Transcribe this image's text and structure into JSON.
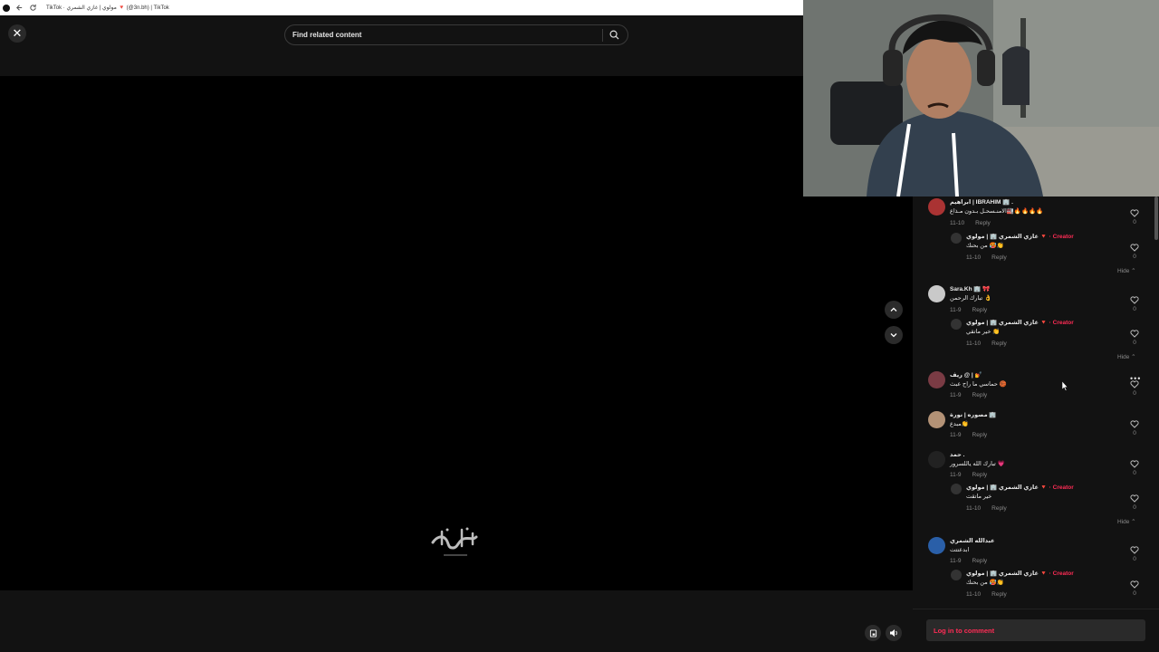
{
  "browser": {
    "tab_title": "TikTok · مولوي | غازي الشمري 🔻 (@3n.bh) | TikTok",
    "icons": [
      "browser-logo-icon",
      "back-icon",
      "reload-icon"
    ]
  },
  "header": {
    "search_placeholder": "Find related content"
  },
  "comments": [
    {
      "user": "ابراهيم | IBRAHIM 🏢 .",
      "text": "الامنـسحـل بـدون مـذاع🏭🔥🔥🔥🔥",
      "date": "11-10",
      "reply": "Reply",
      "likes": "0",
      "replies": [
        {
          "user": "غازي الشمري 🏢 | مولوي 🔻",
          "badge": "· Creator",
          "text": "من بحنك 🥵👏",
          "date": "11-10",
          "reply": "Reply",
          "likes": "0"
        }
      ],
      "hide": "Hide ⌃"
    },
    {
      "user": "Sara.Kh 🏢 🎀",
      "text": "تبارك الرحمن 👌",
      "date": "11-9",
      "reply": "Reply",
      "likes": "0",
      "replies": [
        {
          "user": "غازي الشمري 🏢 | مولوي 🔻",
          "badge": "· Creator",
          "text": "خير ماتقي 👏",
          "date": "11-10",
          "reply": "Reply",
          "likes": "0"
        }
      ],
      "hide": "Hide ⌃"
    },
    {
      "user": "ريف @ | 💅",
      "text": "حماسي ما راح عبث 🏀",
      "date": "11-9",
      "reply": "Reply",
      "likes": "0"
    },
    {
      "user": "مصوره | نورة 🏢",
      "text": "مبدع👏",
      "date": "11-9",
      "reply": "Reply",
      "likes": "0"
    },
    {
      "user": "حمد .",
      "text": "تبارك الله ياللسرور 💗",
      "date": "11-9",
      "reply": "Reply",
      "likes": "0",
      "replies": [
        {
          "user": "غازي الشمري 🏢 | مولوي 🔻",
          "badge": "· Creator",
          "text": "خير ماتقت",
          "date": "11-10",
          "reply": "Reply",
          "likes": "0"
        }
      ],
      "hide": "Hide ⌃"
    },
    {
      "user": "عبدالله الشمري",
      "text": "ابدعتتت",
      "date": "11-9",
      "reply": "Reply",
      "likes": "0",
      "replies": [
        {
          "user": "غازي الشمري 🏢 | مولوي 🔻",
          "badge": "· Creator",
          "text": "من بحنك 🥵👏",
          "date": "11-10",
          "reply": "Reply",
          "likes": "0"
        }
      ]
    }
  ],
  "more_icon": "•••",
  "login": {
    "label": "Log in to comment"
  },
  "colors": {
    "accent": "#fe2c55",
    "panel": "#121212"
  }
}
